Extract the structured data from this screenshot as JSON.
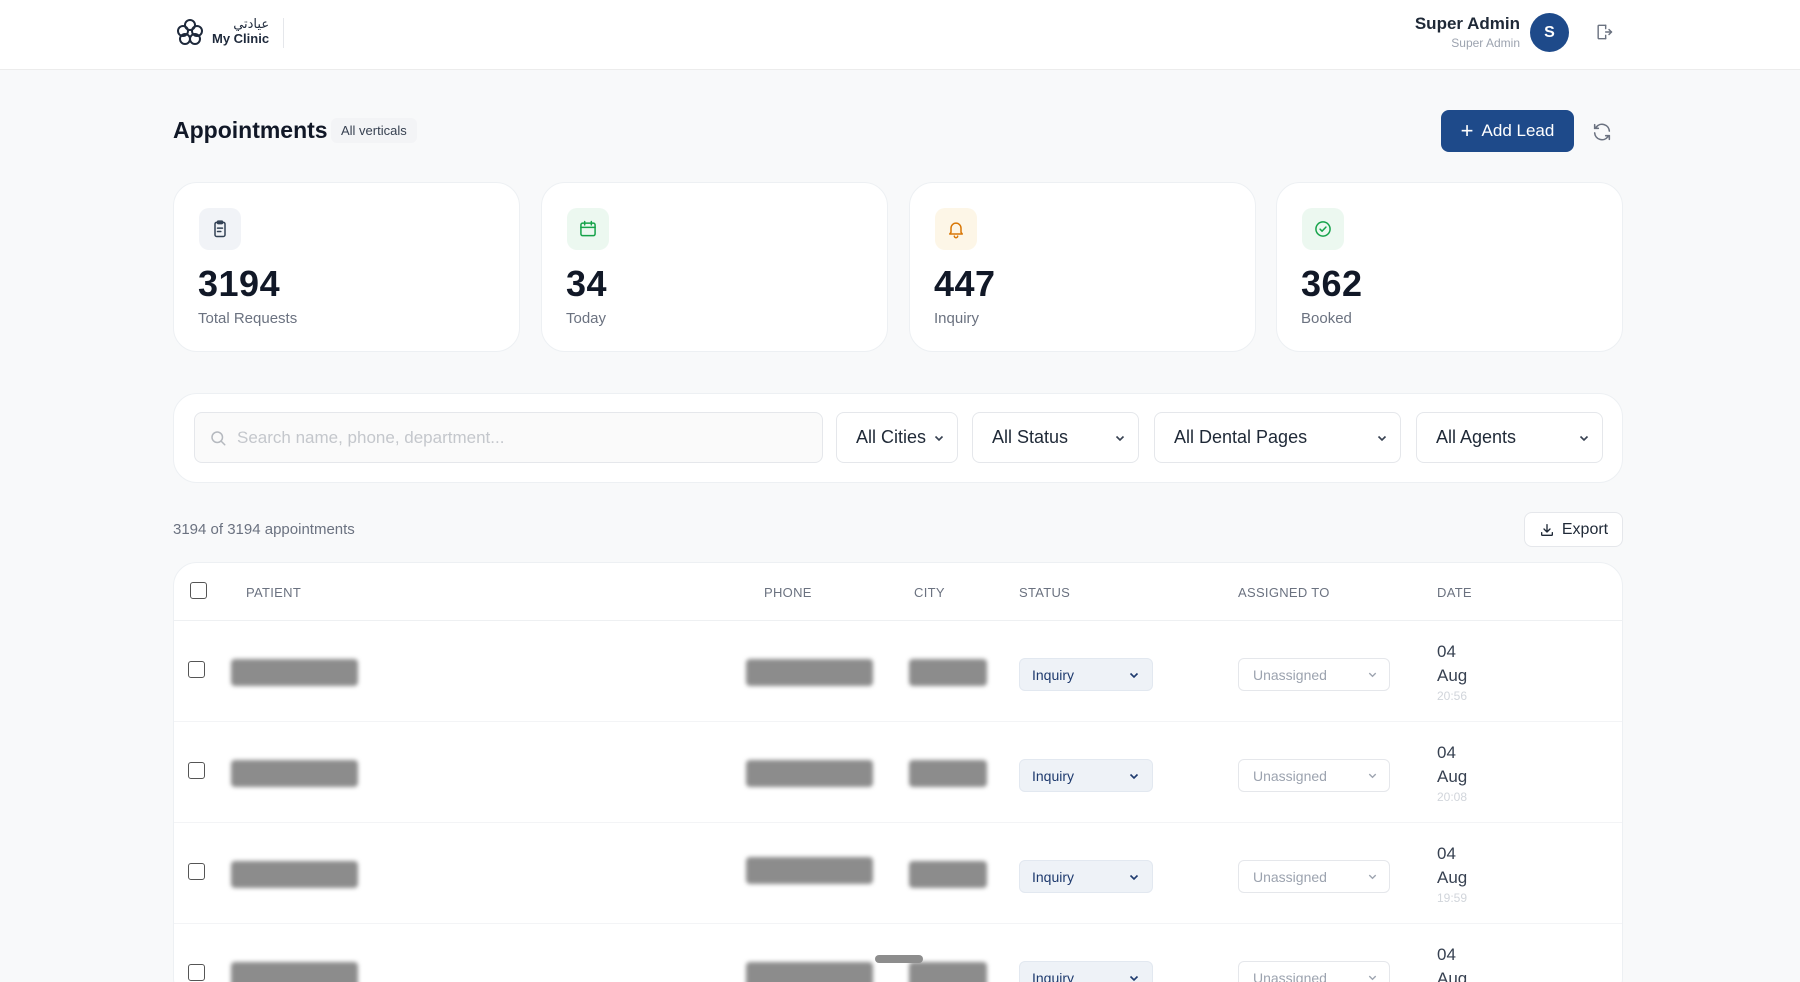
{
  "header": {
    "logo_arabic": "عيادتي",
    "logo_name": "My Clinic",
    "user_name": "Super Admin",
    "user_role": "Super Admin",
    "avatar_initial": "S"
  },
  "page": {
    "title": "Appointments",
    "vertical_badge": "All verticals",
    "add_lead_label": "Add Lead"
  },
  "stats": [
    {
      "value": "3194",
      "label": "Total Requests",
      "icon": "clipboard-icon",
      "color": "#334155",
      "bg": "#f1f3f7"
    },
    {
      "value": "34",
      "label": "Today",
      "icon": "calendar-icon",
      "color": "#16a34a",
      "bg": "#ecf8f0"
    },
    {
      "value": "447",
      "label": "Inquiry",
      "icon": "bell-icon",
      "color": "#d97706",
      "bg": "#fdf6e7"
    },
    {
      "value": "362",
      "label": "Booked",
      "icon": "check-circle-icon",
      "color": "#16a34a",
      "bg": "#ecf8f0"
    }
  ],
  "filters": {
    "search_placeholder": "Search name, phone, department...",
    "city": "All Cities",
    "status": "All Status",
    "dental_pages": "All Dental Pages",
    "agents": "All Agents"
  },
  "results": {
    "count_text": "3194 of 3194 appointments",
    "export_label": "Export"
  },
  "table": {
    "columns": {
      "patient": "PATIENT",
      "phone": "PHONE",
      "city": "CITY",
      "status": "STATUS",
      "assigned": "ASSIGNED TO",
      "date": "DATE"
    },
    "rows": [
      {
        "status": "Inquiry",
        "assigned": "Unassigned",
        "day": "04",
        "month": "Aug",
        "time": "20:56"
      },
      {
        "status": "Inquiry",
        "assigned": "Unassigned",
        "day": "04",
        "month": "Aug",
        "time": "20:08"
      },
      {
        "status": "Inquiry",
        "assigned": "Unassigned",
        "day": "04",
        "month": "Aug",
        "time": "19:59"
      },
      {
        "status": "Inquiry",
        "assigned": "Unassigned",
        "day": "04",
        "month": "Aug",
        "time": ""
      }
    ]
  },
  "colors": {
    "primary": "#1e4a8a",
    "background": "#f8f9fa",
    "card": "#ffffff"
  }
}
